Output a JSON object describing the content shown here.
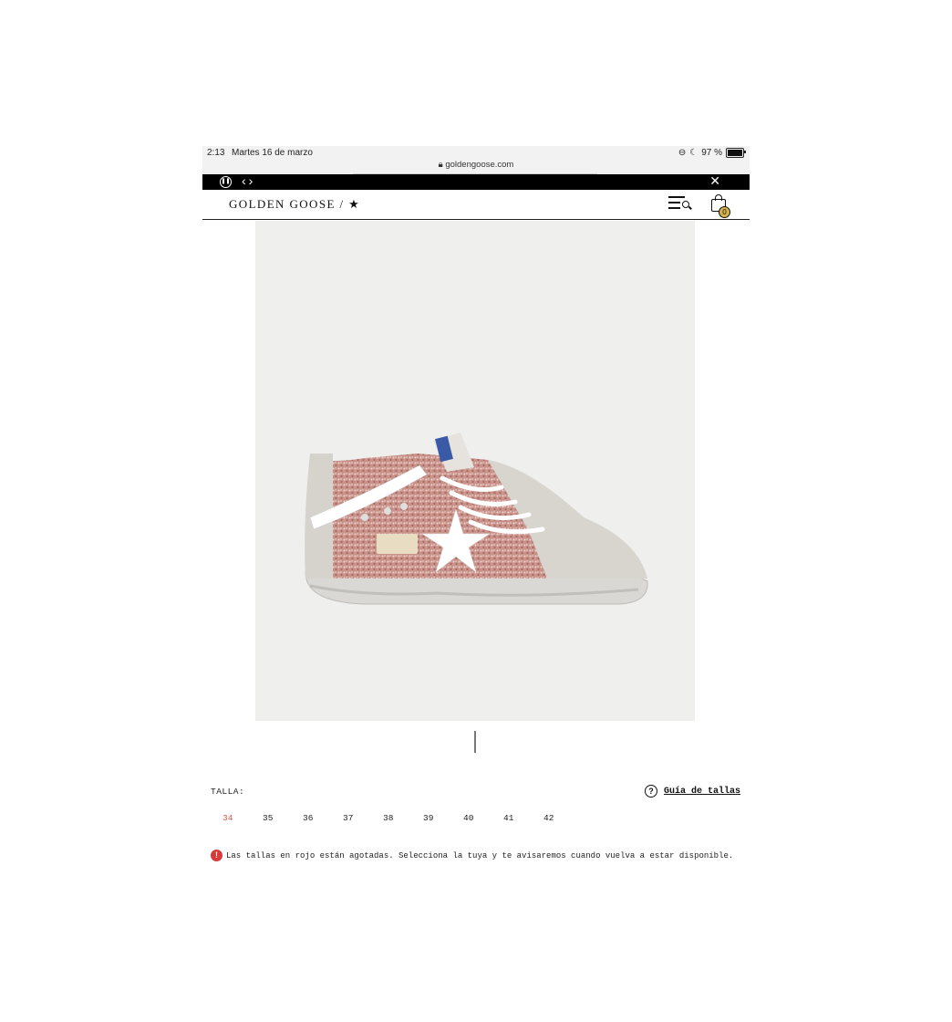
{
  "status_bar": {
    "time": "2:13",
    "date": "Martes 16 de marzo",
    "url": "goldengoose.com",
    "battery": "97 %"
  },
  "promo_bar": {
    "close_symbol": "✕"
  },
  "header": {
    "logo": "GOLDEN GOOSE / ★",
    "cart_count": "0"
  },
  "product": {
    "image_alt": "Mid Star sneaker rosa con glitter"
  },
  "size_selector": {
    "label": "TALLA:",
    "guide_label": "Guía de tallas",
    "sizes": [
      {
        "label": "34",
        "sold_out": true
      },
      {
        "label": "35",
        "sold_out": false
      },
      {
        "label": "36",
        "sold_out": false
      },
      {
        "label": "37",
        "sold_out": false
      },
      {
        "label": "38",
        "sold_out": false
      },
      {
        "label": "39",
        "sold_out": false
      },
      {
        "label": "40",
        "sold_out": false
      },
      {
        "label": "41",
        "sold_out": false
      },
      {
        "label": "42",
        "sold_out": false
      }
    ],
    "sold_out_color": "#d8574f"
  },
  "notice": {
    "text": "Las tallas en rojo están agotadas. Selecciona la tuya y te avisaremos cuando vuelva a estar disponible."
  }
}
